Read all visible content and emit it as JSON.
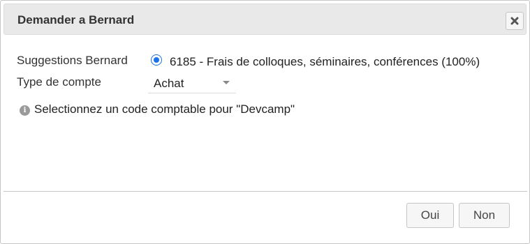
{
  "dialog": {
    "title": "Demander a Bernard",
    "close_icon": "close-icon"
  },
  "form": {
    "suggestions_label": "Suggestions Bernard",
    "suggestion_option": "6185 - Frais de colloques, séminaires, conférences (100%)",
    "suggestion_selected": true,
    "account_type_label": "Type de compte",
    "account_type_value": "Achat",
    "info_icon": "info-icon",
    "info_message": "Selectionnez un code comptable pour \"Devcamp\""
  },
  "buttons": {
    "yes_label": "Oui",
    "no_label": "Non"
  },
  "colors": {
    "radio_accent": "#1a73e8",
    "titlebar_bg": "#e9e9e9",
    "button_bg": "#f6f6f6"
  }
}
